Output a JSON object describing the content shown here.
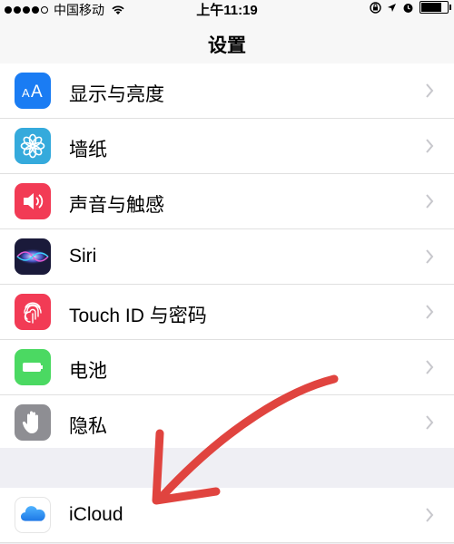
{
  "status_bar": {
    "carrier": "中国移动",
    "time": "上午11:19",
    "signal_icon": "signal-dots-icon",
    "wifi_icon": "wifi-icon",
    "lock_icon": "rotation-lock-icon",
    "location_icon": "location-arrow-icon",
    "alarm_icon": "alarm-icon",
    "battery_icon": "battery-icon",
    "battery_level": 0.85
  },
  "nav": {
    "title": "设置"
  },
  "settings": [
    {
      "label": "显示与亮度",
      "icon": "display-brightness-icon",
      "color": "#1a7cf3"
    },
    {
      "label": "墙纸",
      "icon": "wallpaper-flower-icon",
      "color": "#35aadc"
    },
    {
      "label": "声音与触感",
      "icon": "sound-speaker-icon",
      "color": "#f23b55"
    },
    {
      "label": "Siri",
      "icon": "siri-icon",
      "color": "#1a1a3a"
    },
    {
      "label": "Touch ID 与密码",
      "icon": "fingerprint-icon",
      "color": "#f23b55"
    },
    {
      "label": "电池",
      "icon": "battery-setting-icon",
      "color": "#4bd962"
    },
    {
      "label": "隐私",
      "icon": "privacy-hand-icon",
      "color": "#8e8e93"
    }
  ],
  "icloud": {
    "label": "iCloud",
    "icon": "icloud-icon",
    "color": "#1e90ff"
  },
  "annotation": {
    "arrow_color": "#e0443f"
  }
}
